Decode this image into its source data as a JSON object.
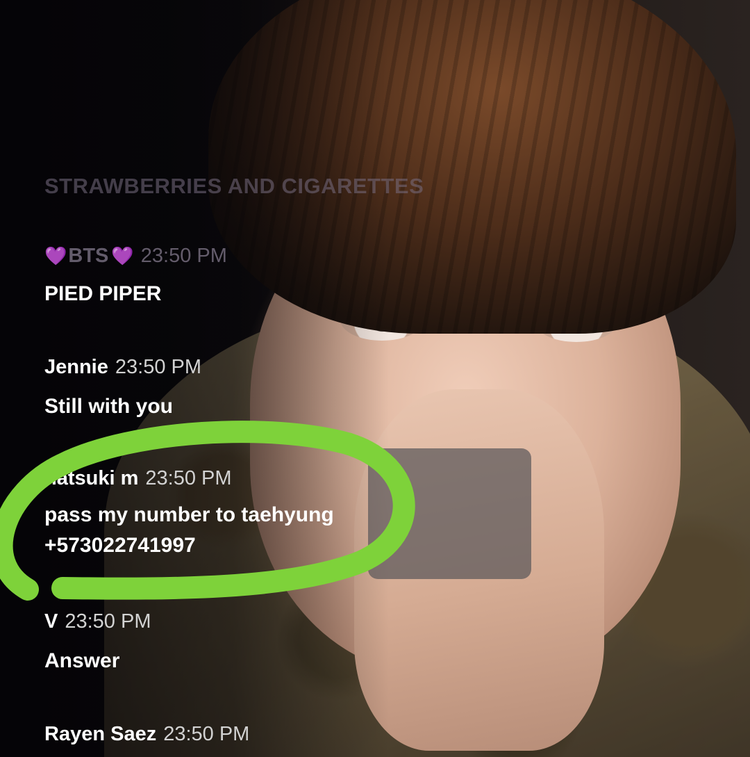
{
  "chat": {
    "title": "STRAWBERRIES AND CIGARETTES",
    "messages": [
      {
        "name_prefix_icon": "purple-heart",
        "name": "BTS",
        "name_suffix_icon": "purple-heart",
        "time": "23:50 PM",
        "text": "PIED PIPER"
      },
      {
        "name": "Jennie",
        "time": "23:50 PM",
        "text": "Still with you"
      },
      {
        "name": "natsuki m",
        "time": "23:50 PM",
        "text": "pass my number to taehyung",
        "text_line2": "+573022741997"
      },
      {
        "name": "V",
        "time": "23:50 PM",
        "text": "Answer"
      },
      {
        "name": "Rayen Saez",
        "time": "23:50 PM"
      }
    ]
  },
  "glyphs": {
    "heart": "💜"
  },
  "colors": {
    "highlight": "#7ed23a",
    "heart": "#7b3fb8",
    "text": "#ffffff",
    "time": "#d2d2d2"
  }
}
